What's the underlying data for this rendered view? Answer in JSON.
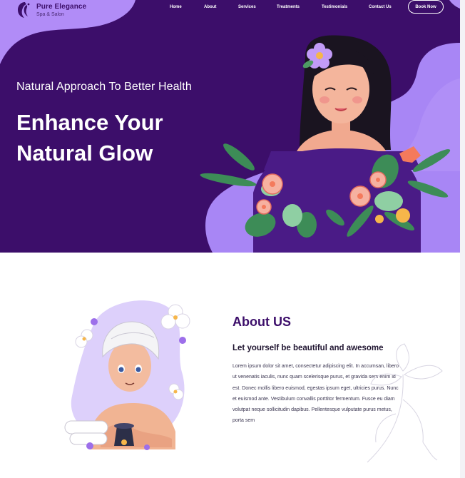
{
  "brand": {
    "title": "Pure Elegance",
    "subtitle": "Spa & Salon"
  },
  "nav": {
    "links": [
      "Home",
      "About",
      "Services",
      "Treatments",
      "Testimonials",
      "Contact Us"
    ],
    "cta": "Book Now"
  },
  "hero": {
    "tagline": "Natural Approach To Better Health",
    "title_line1": "Enhance Your",
    "title_line2": "Natural Glow"
  },
  "about": {
    "heading": "About US",
    "subheading": "Let yourself be beautiful and awesome",
    "body": "Lorem ipsum dolor sit amet, consectetur adipiscing elit. In accumsan, libero ut venenatis iaculis, nunc quam scelerisque purus, et gravida sem enim id est. Donec mollis libero euismod, egestas ipsum eget, ultricies purus. Nunc et euismod ante. Vestibulum convallis porttitor fermentum. Fusce eu diam volutpat neque sollicitudin dapibus. Pellentesque vulputate purus metus, porta sem"
  },
  "colors": {
    "primary": "#3c0e6a",
    "lavender": "#b18cf7",
    "light_lavender": "#ddd0fb",
    "white": "#ffffff"
  },
  "icons": [
    "woman-profile-logo-icon",
    "woman-with-flowers-illustration",
    "spa-woman-towel-illustration",
    "flower-sketch-decoration"
  ]
}
